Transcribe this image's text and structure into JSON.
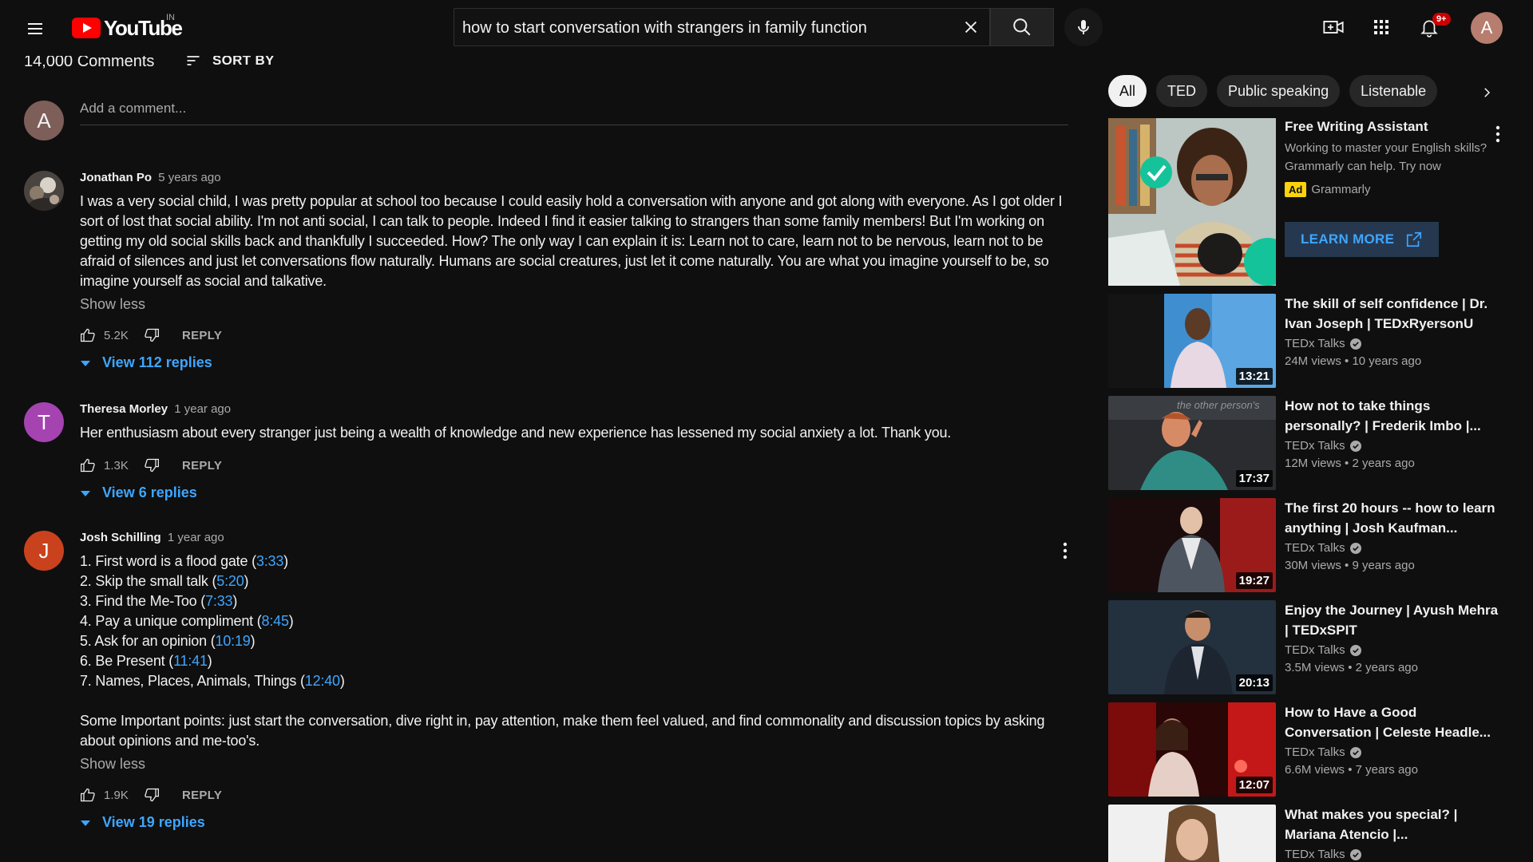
{
  "header": {
    "logo_text": "YouTube",
    "country_code": "IN",
    "search_value": "how to start conversation with strangers in family function",
    "notification_count": "9+",
    "account_initial": "A"
  },
  "comments_section": {
    "count_label": "14,000 Comments",
    "sort_label": "SORT BY",
    "add_comment_avatar": "A",
    "add_comment_placeholder": "Add a comment...",
    "comments": [
      {
        "author": "Jonathan Po",
        "time": "5 years ago",
        "text": "I was a very social child, I was pretty popular at school too because I could easily hold a conversation with anyone and got along with everyone. As I got older I sort of lost that social ability. I'm not anti social, I can talk to people. Indeed I find it easier talking to strangers than some family members! But I'm working on getting my old social skills back and thankfully I succeeded. How? The only way I can explain it is: Learn not to care, learn not to be nervous, learn not to be afraid of silences and just let conversations flow naturally. Humans are social creatures, just let it come naturally. You are what you imagine yourself to be, so imagine yourself as social and talkative.",
        "show_less": "Show less",
        "likes": "5.2K",
        "reply": "REPLY",
        "view_replies": "View 112 replies"
      },
      {
        "author": "Theresa Morley",
        "avatar_initial": "T",
        "time": "1 year ago",
        "text": "Her enthusiasm about every stranger just being a wealth of knowledge and new experience has lessened my social anxiety a lot. Thank you.",
        "likes": "1.3K",
        "reply": "REPLY",
        "view_replies": "View 6 replies"
      },
      {
        "author": "Josh Schilling",
        "avatar_initial": "J",
        "time": "1 year ago",
        "list": [
          {
            "text": "1. First word is a flood gate (",
            "ts": "3:33",
            "end": ")"
          },
          {
            "text": "2. Skip the small talk (",
            "ts": "5:20",
            "end": ")"
          },
          {
            "text": "3. Find the Me-Too (",
            "ts": "7:33",
            "end": ")"
          },
          {
            "text": "4. Pay a unique compliment (",
            "ts": "8:45",
            "end": ")"
          },
          {
            "text": "5. Ask for an opinion (",
            "ts": "10:19",
            "end": ")"
          },
          {
            "text": "6. Be Present (",
            "ts": "11:41",
            "end": ")"
          },
          {
            "text": "7. Names, Places, Animals, Things (",
            "ts": "12:40",
            "end": ")"
          }
        ],
        "extra": "Some Important points: just start the conversation, dive right in, pay attention, make them feel valued, and find commonality and discussion topics by asking about opinions and me-too's.",
        "show_less": "Show less",
        "likes": "1.9K",
        "reply": "REPLY",
        "view_replies": "View 19 replies"
      }
    ]
  },
  "sidebar": {
    "chips": [
      "All",
      "TED",
      "Public speaking",
      "Listenable"
    ],
    "ad": {
      "title": "Free Writing Assistant",
      "description": "Working to master your English skills? Grammarly can help. Try now",
      "badge": "Ad",
      "advertiser": "Grammarly",
      "cta": "LEARN MORE"
    },
    "videos": [
      {
        "title": "The skill of self confidence | Dr. Ivan Joseph | TEDxRyersonU",
        "channel": "TEDx Talks",
        "meta": "24M views • 10 years ago",
        "duration": "13:21"
      },
      {
        "title": "How not to take things personally? | Frederik Imbo |...",
        "channel": "TEDx Talks",
        "meta": "12M views • 2 years ago",
        "duration": "17:37",
        "thumb_caption": "the other person's"
      },
      {
        "title": "The first 20 hours -- how to learn anything | Josh Kaufman...",
        "channel": "TEDx Talks",
        "meta": "30M views • 9 years ago",
        "duration": "19:27"
      },
      {
        "title": "Enjoy the Journey | Ayush Mehra | TEDxSPIT",
        "channel": "TEDx Talks",
        "meta": "3.5M views • 2 years ago",
        "duration": "20:13"
      },
      {
        "title": "How to Have a Good Conversation | Celeste Headle...",
        "channel": "TEDx Talks",
        "meta": "6.6M views • 7 years ago",
        "duration": "12:07"
      },
      {
        "title": "What makes you special? | Mariana Atencio |...",
        "channel": "TEDx Talks",
        "meta": "",
        "duration": ""
      }
    ]
  },
  "colors": {
    "background": "#0f0f0f",
    "link_blue": "#3ea6ff",
    "youtube_red": "#ff0000",
    "text_secondary": "#aaaaaa",
    "ad_yellow": "#fbd30c"
  }
}
